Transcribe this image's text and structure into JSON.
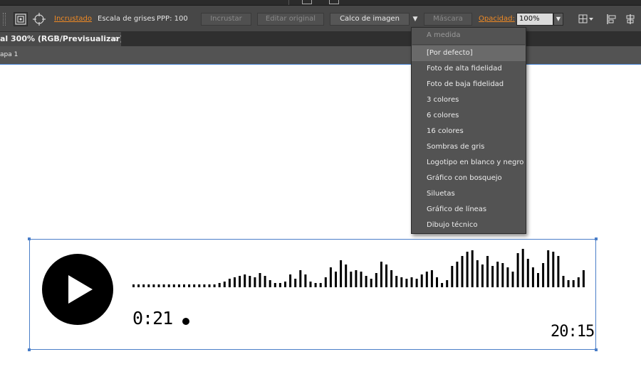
{
  "control_bar": {
    "embedded_link": "Incrustado",
    "color_mode": "Escala de grises",
    "ppi": "PPP: 100",
    "embed_button": "Incrustar",
    "edit_original_button": "Editar original",
    "trace_select_value": "Calco de imagen",
    "mask_button": "Máscara",
    "opacity_label": "Opacidad:",
    "opacity_value": "100%"
  },
  "document_tab": {
    "title": "al 300% (RGB/Previsualizar)",
    "close": "×"
  },
  "breadcrumb": {
    "layer": "apa 1"
  },
  "trace_presets": {
    "header": "A medida",
    "items": [
      "[Por defecto]",
      "Foto de alta fidelidad",
      "Foto de baja fidelidad",
      "3 colores",
      "6 colores",
      "16 colores",
      "Sombras de gris",
      "Logotipo en blanco y negro",
      "Gráfico con bosquejo",
      "Siluetas",
      "Gráfico de líneas",
      "Dibujo técnico"
    ],
    "selected_index": 0
  },
  "artwork": {
    "elapsed": "0:21",
    "duration": "20:15"
  },
  "colors": {
    "accent_link": "#f08a24",
    "selection_blue": "#4a7ec8"
  }
}
